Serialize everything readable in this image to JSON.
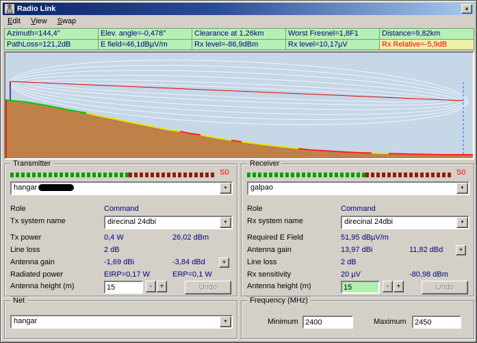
{
  "window": {
    "title": "Radio Link"
  },
  "icons": {
    "close": "×",
    "dropdown": "▼"
  },
  "menu": {
    "items": [
      "Edit",
      "View",
      "Swap"
    ]
  },
  "info": {
    "row1": [
      "Azimuth=144,4°",
      "Elev. angle=-0,478°",
      "Clearance at 1,26km",
      "Worst Fresnel=1,8F1",
      "Distance=9,82km"
    ],
    "row2": [
      "PathLoss=121,2dB",
      "E field=46,1dBµV/m",
      "Rx level=-86,9dBm",
      "Rx level=10,17µV",
      "Rx Relative=-5,9dB"
    ]
  },
  "transmitter": {
    "label": "Transmitter",
    "signal": "S0",
    "station": "hangar",
    "role_label": "Role",
    "role": "Command",
    "system_label": "Tx system name",
    "system": "direcinal 24dbi",
    "power_label": "Tx power",
    "power_w": "0,4 W",
    "power_dbm": "26,02 dBm",
    "lineloss_label": "Line loss",
    "lineloss": "2 dB",
    "gain_label": "Antenna gain",
    "gain_dbi": "-1,69 dBi",
    "gain_dbd": "-3,84 dBd",
    "gain_btn": "+",
    "radiated_label": "Radiated power",
    "eirp": "EIRP=0,17 W",
    "erp": "ERP=0,1 W",
    "height_label": "Antenna height (m)",
    "height": "15",
    "minus": "-",
    "plus": "+",
    "undo": "Undo"
  },
  "receiver": {
    "label": "Receiver",
    "signal": "S0",
    "station": "galpao",
    "role_label": "Role",
    "role": "Command",
    "system_label": "Rx system name",
    "system": "direcinal 24dbi",
    "efield_label": "Required E Field",
    "efield": "51,95 dBµV/m",
    "gain_label": "Antenna gain",
    "gain_dbi": "13,97 dBi",
    "gain_dbd": "11,82 dBd",
    "gain_btn": "+",
    "lineloss_label": "Line loss",
    "lineloss": "2 dB",
    "sens_label": "Rx sensitivity",
    "sens_uv": "20 µV",
    "sens_dbm": "-80,98 dBm",
    "height_label": "Antenna height (m)",
    "height": "15",
    "minus": "-",
    "plus": "+",
    "undo": "Undo"
  },
  "net": {
    "label": "Net",
    "station": "hangar"
  },
  "frequency": {
    "label": "Frequency (MHz)",
    "min_label": "Minimum",
    "min": "2400",
    "max_label": "Maximum",
    "max": "2450"
  },
  "colors": {
    "title_bar": "#0a246a",
    "info_ok_bg": "#b6f0b6",
    "info_warn_bg": "#eef0a8",
    "value_text": "#000080",
    "warn_text": "#ff0000",
    "meter_green": "#00a000",
    "meter_red": "#8f1f00",
    "sky": "#c6d7e7",
    "terrain": "#bf8148",
    "ground_clear": "#00cc00",
    "ground_marginal": "#e6e600",
    "ground_obstructed": "#ff2020",
    "line_of_sight": "#e00000",
    "height_changed_bg": "#b0f0b0"
  }
}
